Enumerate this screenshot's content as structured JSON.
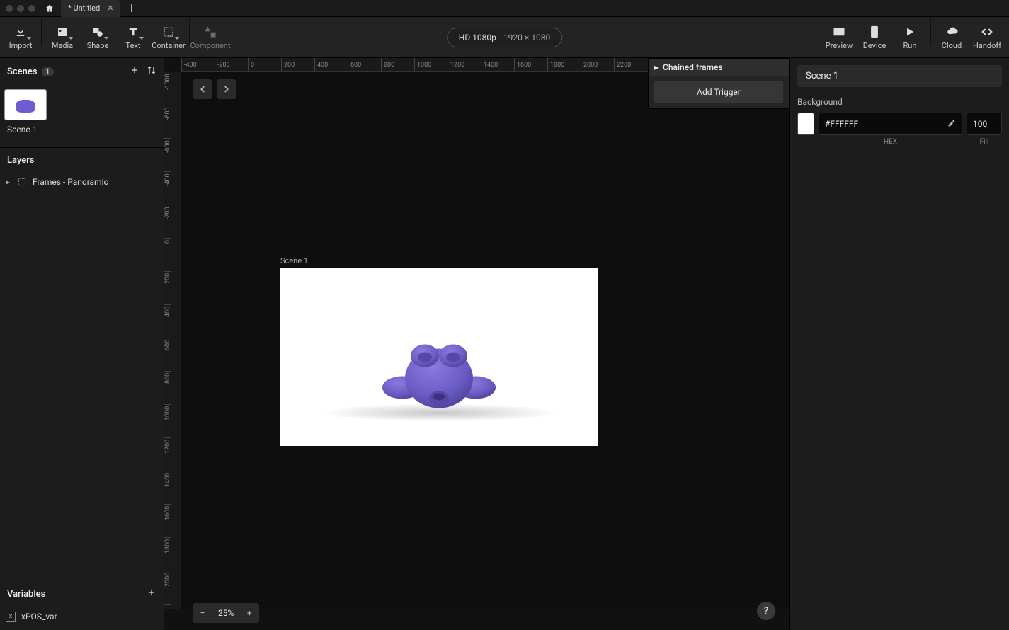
{
  "titlebar": {
    "tab_title": "* Untitled"
  },
  "toolbar": {
    "left": [
      {
        "id": "import",
        "label": "Import"
      },
      {
        "id": "media",
        "label": "Media"
      },
      {
        "id": "shape",
        "label": "Shape"
      },
      {
        "id": "text",
        "label": "Text"
      },
      {
        "id": "container",
        "label": "Container"
      },
      {
        "id": "component",
        "label": "Component"
      }
    ],
    "format_name": "HD 1080p",
    "format_dims": "1920 × 1080",
    "right": [
      {
        "id": "preview",
        "label": "Preview"
      },
      {
        "id": "device",
        "label": "Device"
      },
      {
        "id": "run",
        "label": "Run"
      },
      {
        "id": "cloud",
        "label": "Cloud"
      },
      {
        "id": "handoff",
        "label": "Handoff"
      }
    ]
  },
  "scenes": {
    "title": "Scenes",
    "count": "1",
    "items": [
      {
        "label": "Scene 1"
      }
    ]
  },
  "layers": {
    "title": "Layers",
    "items": [
      {
        "label": "Frames - Panoramic"
      }
    ]
  },
  "variables": {
    "title": "Variables",
    "items": [
      {
        "label": "xPOS_var"
      }
    ]
  },
  "canvas": {
    "scene_label": "Scene 1",
    "zoom": "25%",
    "h_ticks": [
      "-400",
      "-200",
      "0",
      "200",
      "400",
      "600",
      "800",
      "1000",
      "1200",
      "1400",
      "1600",
      "1800",
      "2000",
      "2200"
    ],
    "v_ticks": [
      "-1000",
      "-800",
      "-600",
      "-400",
      "-200",
      "0",
      "200",
      "400",
      "600",
      "800",
      "1000",
      "1200",
      "1400",
      "1600",
      "1800",
      "2000"
    ]
  },
  "chained": {
    "title": "Chained frames",
    "add_trigger": "Add Trigger"
  },
  "right": {
    "scene_name": "Scene 1",
    "background_label": "Background",
    "hex": "#FFFFFF",
    "fill": "100",
    "hex_sub": "HEX",
    "fill_sub": "Fill"
  }
}
